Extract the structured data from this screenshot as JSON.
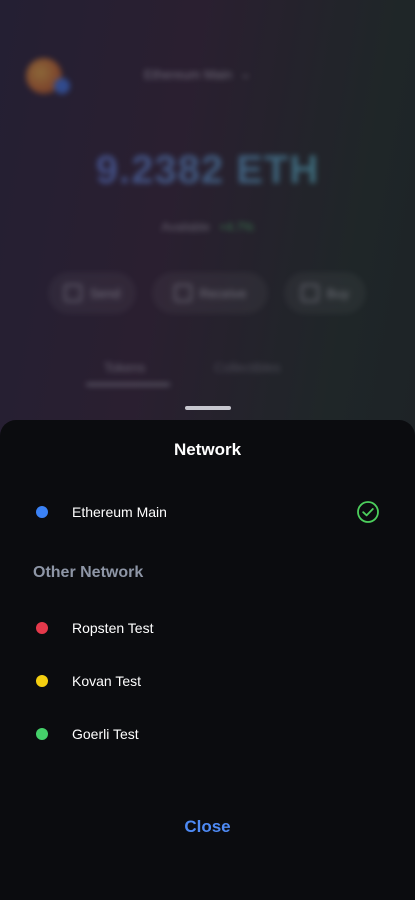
{
  "background": {
    "network_selector": "Ethereum Main",
    "balance": "9.2382 ETH",
    "sub_label": "Available",
    "sub_change": "+4.7%",
    "actions": [
      {
        "label": "Send",
        "icon": "send-icon"
      },
      {
        "label": "Receive",
        "icon": "receive-icon"
      },
      {
        "label": "Buy",
        "icon": "buy-icon"
      }
    ],
    "tabs": [
      "Tokens",
      "Collectibles"
    ]
  },
  "sheet": {
    "title": "Network",
    "current": {
      "label": "Ethereum Main",
      "color": "#3b82f6",
      "selected": true
    },
    "section_label": "Other Network",
    "others": [
      {
        "label": "Ropsten Test",
        "color": "#e5394b"
      },
      {
        "label": "Kovan Test",
        "color": "#f5cf10"
      },
      {
        "label": "Goerli Test",
        "color": "#45d06a"
      }
    ],
    "close_label": "Close",
    "check_color": "#4ccf5c",
    "accent": "#4e8af4"
  }
}
